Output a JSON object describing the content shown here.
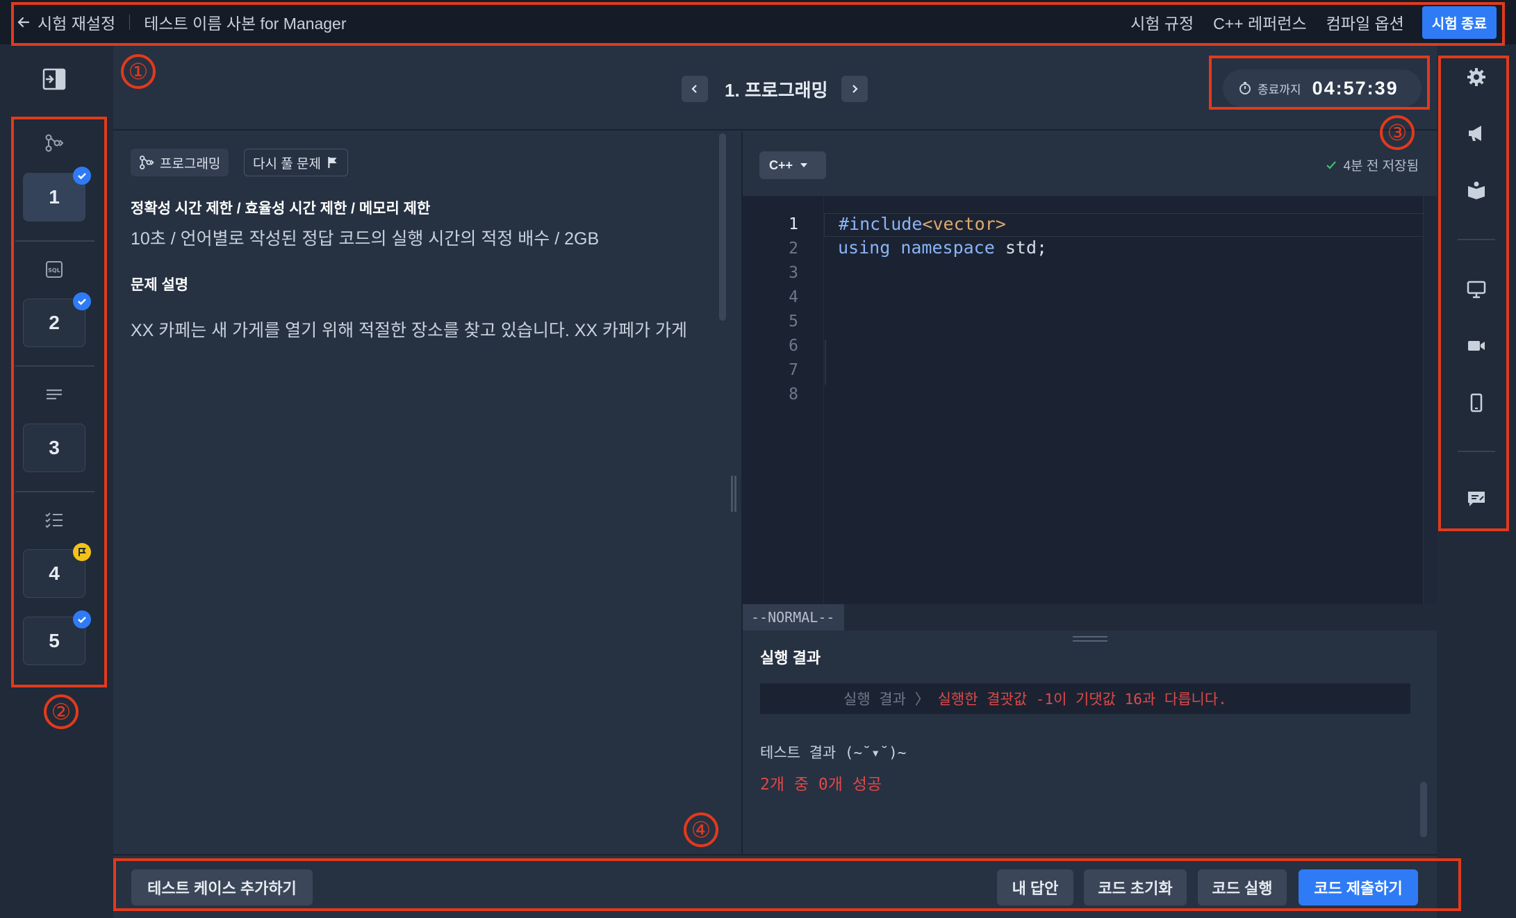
{
  "topbar": {
    "back_label": "시험 재설정",
    "test_title": "테스트 이름 사본 for Manager",
    "links": [
      "시험 규정",
      "C++ 레퍼런스",
      "컴파일 옵션"
    ],
    "end_button": "시험 종료"
  },
  "header": {
    "problem_title": "1. 프로그래밍",
    "timer_label": "종료까지",
    "timer_value": "04:57:39"
  },
  "questions": [
    {
      "number": "1",
      "category_icon": "programming-icon",
      "status": "checked"
    },
    {
      "number": "2",
      "category_icon": "sql-icon",
      "status": "checked"
    },
    {
      "number": "3",
      "category_icon": "text-lines-icon",
      "status": "none"
    },
    {
      "number": "4",
      "category_icon": "checklist-icon",
      "status": "flagged"
    },
    {
      "number": "5",
      "category_icon": "checklist-icon",
      "status": "checked"
    }
  ],
  "description": {
    "tag_type": "프로그래밍",
    "tag_review": "다시 풀 문제",
    "limits_heading": "정확성 시간 제한 / 효율성 시간 제한 / 메모리 제한",
    "limits_text": "10초 / 언어별로 작성된 정답 코드의 실행 시간의 적정 배수 / 2GB",
    "section_heading": "문제 설명",
    "body_text": "XX 카페는 새 가게를 열기 위해 적절한 장소를 찾고 있습니다. XX 카페가 가게"
  },
  "editor": {
    "language": "C++",
    "saved_status": "4분 전 저장됨",
    "line_numbers": [
      "1",
      "2",
      "3",
      "4",
      "5",
      "6",
      "7",
      "8"
    ],
    "code_line1_directive": "#include",
    "code_line1_header": "<vector>",
    "code_line2_kw1": "using",
    "code_line2_kw2": "namespace",
    "code_line2_rest": "std;",
    "mode": "--NORMAL--"
  },
  "result": {
    "title": "실행 결과",
    "row_key": "실행 결과 〉",
    "row_value": "실행한 결괏값 -1이 기댓값 16과 다릅니다.",
    "test_label": "테스트 결과 (~˘▾˘)~",
    "test_value": "2개 중 0개 성공"
  },
  "bottombar": {
    "add_testcase": "테스트 케이스 추가하기",
    "my_answer": "내 답안",
    "reset_code": "코드 초기화",
    "run_code": "코드 실행",
    "submit_code": "코드 제출하기"
  },
  "annotations": [
    "①",
    "②",
    "③",
    "④"
  ],
  "colors": {
    "accent": "#2f7bf5",
    "error": "#e04848",
    "flag": "#f4c218",
    "annotation": "#e23a1c"
  }
}
